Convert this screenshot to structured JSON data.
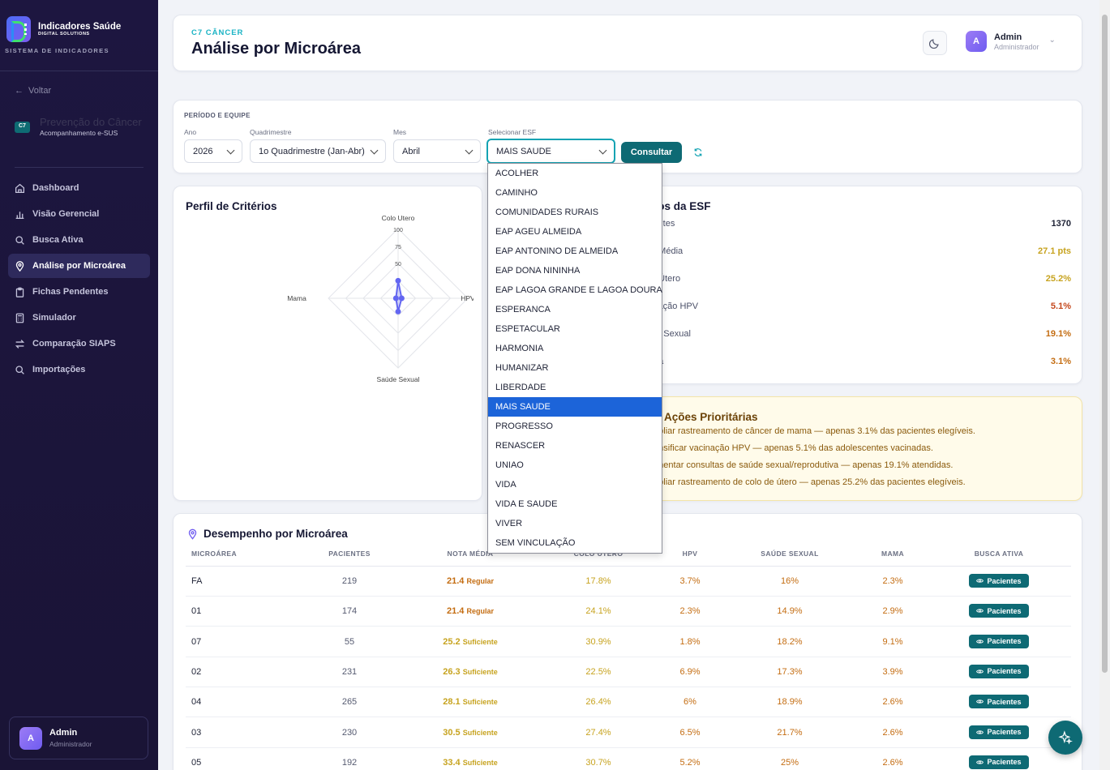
{
  "sidebar": {
    "brand_title": "Indicadores Saúde",
    "brand_sub": "DIGITAL SOLUTIONS",
    "system_label": "SISTEMA DE INDICADORES",
    "back_label": "Voltar",
    "module_badge": "C7",
    "module_name": "Prevenção do Câncer",
    "module_sub": "Acompanhamento e-SUS",
    "items": [
      {
        "label": "Dashboard",
        "icon": "home-icon"
      },
      {
        "label": "Visão Gerencial",
        "icon": "bar-chart-icon"
      },
      {
        "label": "Busca Ativa",
        "icon": "search-icon"
      },
      {
        "label": "Análise por Microárea",
        "icon": "map-pin-icon"
      },
      {
        "label": "Fichas Pendentes",
        "icon": "clipboard-icon"
      },
      {
        "label": "Simulador",
        "icon": "calculator-icon"
      },
      {
        "label": "Comparação SIAPS",
        "icon": "arrows-icon"
      },
      {
        "label": "Importações",
        "icon": "search-icon"
      }
    ],
    "user_initial": "A",
    "user_name": "Admin",
    "user_role": "Administrador"
  },
  "header": {
    "kicker": "C7 CÂNCER",
    "title": "Análise por Microárea",
    "user_initial": "A",
    "user_name": "Admin",
    "user_role": "Administrador"
  },
  "filters": {
    "section_label": "PERÍODO E EQUIPE",
    "ano_label": "Ano",
    "ano_value": "2026",
    "quad_label": "Quadrimestre",
    "quad_value": "1o Quadrimestre (Jan-Abr)",
    "mes_label": "Mes",
    "mes_value": "Abril",
    "esf_label": "Selecionar ESF",
    "esf_value": "MAIS SAUDE",
    "consult_label": "Consultar"
  },
  "esf_options": [
    "ACOLHER",
    "CAMINHO",
    "COMUNIDADES RURAIS",
    "EAP AGEU ALMEIDA",
    "EAP ANTONINO DE ALMEIDA",
    "EAP DONA NININHA",
    "EAP LAGOA GRANDE E LAGOA DOURA",
    "ESPERANCA",
    "ESPETACULAR",
    "HARMONIA",
    "HUMANIZAR",
    "LIBERDADE",
    "MAIS SAUDE",
    "PROGRESSO",
    "RENASCER",
    "UNIAO",
    "VIDA",
    "VIDA E SAUDE",
    "VIVER",
    "SEM VINCULAÇÃO"
  ],
  "profile": {
    "title": "Perfil de Critérios",
    "axes": [
      "Colo Útero",
      "HPV",
      "Saúde Sexual",
      "Mama"
    ],
    "ticks": [
      "100",
      "75",
      "50"
    ]
  },
  "chart_data": {
    "type": "radar",
    "categories": [
      "Colo Útero",
      "HPV",
      "Saúde Sexual",
      "Mama"
    ],
    "values": [
      25.2,
      5.1,
      19.1,
      3.1
    ],
    "rlim": [
      0,
      100
    ]
  },
  "results": {
    "title": "dos da ESF",
    "rows": [
      {
        "label": "ientes",
        "value": "1370",
        "color": "#1e2235"
      },
      {
        "label": "a Média",
        "value": "27.1 pts",
        "color": "#c7a31f"
      },
      {
        "label": "o Útero",
        "value": "25.2%",
        "color": "#c7a31f"
      },
      {
        "label": "inação HPV",
        "value": "5.1%",
        "color": "#c4471c"
      },
      {
        "label": "de Sexual",
        "value": "19.1%",
        "color": "#c46d12"
      },
      {
        "label": "ma",
        "value": "3.1%",
        "color": "#c46d12"
      }
    ]
  },
  "priority": {
    "title": "Ações Prioritárias",
    "items": [
      "mpliar rastreamento de câncer de mama — apenas 3.1% das pacientes elegíveis.",
      "tensificar vacinação HPV — apenas 5.1% das adolescentes vacinadas.",
      "umentar consultas de saúde sexual/reprodutiva — apenas 19.1% atendidas.",
      "mpliar rastreamento de colo de útero — apenas 25.2% das pacientes elegíveis."
    ]
  },
  "table": {
    "title": "Desempenho por Microárea",
    "headers": [
      "MICROÁREA",
      "PACIENTES",
      "NOTA MÉDIA",
      "COLO ÚTERO",
      "HPV",
      "SAÚDE SEXUAL",
      "MAMA",
      "BUSCA ATIVA"
    ],
    "button_label": "Pacientes",
    "rows": [
      {
        "micro": "FA",
        "pac": "219",
        "nota": "21.4",
        "status": "Regular",
        "colo": "17.8%",
        "hpv": "3.7%",
        "sexual": "16%",
        "mama": "2.3%"
      },
      {
        "micro": "01",
        "pac": "174",
        "nota": "21.4",
        "status": "Regular",
        "colo": "24.1%",
        "hpv": "2.3%",
        "sexual": "14.9%",
        "mama": "2.9%"
      },
      {
        "micro": "07",
        "pac": "55",
        "nota": "25.2",
        "status": "Suficiente",
        "colo": "30.9%",
        "hpv": "1.8%",
        "sexual": "18.2%",
        "mama": "9.1%"
      },
      {
        "micro": "02",
        "pac": "231",
        "nota": "26.3",
        "status": "Suficiente",
        "colo": "22.5%",
        "hpv": "6.9%",
        "sexual": "17.3%",
        "mama": "3.9%"
      },
      {
        "micro": "04",
        "pac": "265",
        "nota": "28.1",
        "status": "Suficiente",
        "colo": "26.4%",
        "hpv": "6%",
        "sexual": "18.9%",
        "mama": "2.6%"
      },
      {
        "micro": "03",
        "pac": "230",
        "nota": "30.5",
        "status": "Suficiente",
        "colo": "27.4%",
        "hpv": "6.5%",
        "sexual": "21.7%",
        "mama": "2.6%"
      },
      {
        "micro": "05",
        "pac": "192",
        "nota": "33.4",
        "status": "Suficiente",
        "colo": "30.7%",
        "hpv": "5.2%",
        "sexual": "25%",
        "mama": "2.6%"
      }
    ]
  }
}
